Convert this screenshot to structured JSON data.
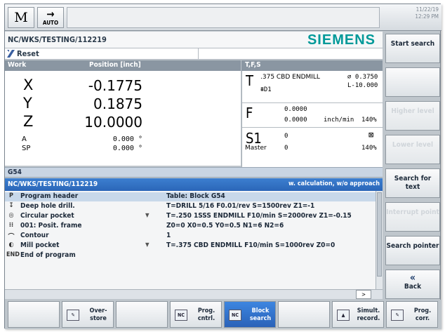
{
  "top": {
    "mode_symbol": "M",
    "mode_auto": "AUTO",
    "date": "11/22/19",
    "time": "12:29 PM"
  },
  "path": "NC/WKS/TESTING/112219",
  "brand": "SIEMENS",
  "status": "Reset",
  "position": {
    "header_work": "Work",
    "header_position": "Position [inch]",
    "axes": [
      {
        "name": "X",
        "value": "-0.1775"
      },
      {
        "name": "Y",
        "value": "0.1875"
      },
      {
        "name": "Z",
        "value": "10.0000"
      }
    ],
    "aux_axes": [
      {
        "name": "A",
        "value": "0.000 °"
      },
      {
        "name": "SP",
        "value": "0.000 °"
      }
    ]
  },
  "tfs": {
    "header": "T,F,S",
    "tool_letter": "T",
    "tool_name": ".375 CBD ENDMILL",
    "tool_diameter": "⌀ 0.3750",
    "tool_length": "L-10.000",
    "tool_edge": "D1",
    "feed_letter": "F",
    "feed_actual": "0.0000",
    "feed_prog": "0.0000",
    "feed_unit": "inch/min",
    "feed_override": "140%",
    "spindle_letter": "S1",
    "spindle_actual": "0",
    "spindle_prog": "0",
    "spindle_override": "140%",
    "spindle_mode": "Master"
  },
  "work_offset": "G54",
  "program": {
    "header_path": "NC/WKS/TESTING/112219",
    "header_note": "w. calculation, w/o approach",
    "rows": [
      {
        "icon": "P",
        "name": "Program header",
        "desc": "Table: Block G54",
        "selected": true,
        "tri": ""
      },
      {
        "icon": "↧",
        "name": "Deep hole drill.",
        "desc": "T=DRILL 5/16 F0.01/rev S=1500rev Z1=-1",
        "selected": false,
        "tri": ""
      },
      {
        "icon": "◎",
        "name": "Circular pocket",
        "desc": "T=.250 1SSS ENDMILL F10/min S=2000rev Z1=-0.15",
        "selected": false,
        "tri": "▼"
      },
      {
        "icon": "⁝⁝",
        "name": "001: Posit. frame",
        "desc": "Z0=0 X0=0.5 Y0=0.5 N1=6 N2=6",
        "selected": false,
        "tri": ""
      },
      {
        "icon": "⌒",
        "name": "Contour",
        "desc": "1",
        "selected": false,
        "tri": ""
      },
      {
        "icon": "◐",
        "name": "Mill pocket",
        "desc": "T=.375 CBD ENDMILL F10/min S=1000rev Z0=0",
        "selected": false,
        "tri": "▼"
      },
      {
        "icon": "END",
        "name": "End of program",
        "desc": "",
        "selected": false,
        "tri": ""
      }
    ],
    "foot_arrow": ">"
  },
  "vertical_softkeys": [
    {
      "label": "Start search",
      "enabled": true
    },
    {
      "label": "",
      "enabled": true
    },
    {
      "label": "Higher level",
      "enabled": false
    },
    {
      "label": "Lower level",
      "enabled": false
    },
    {
      "label": "Search for text",
      "enabled": true
    },
    {
      "label": "Interrupt point",
      "enabled": false
    },
    {
      "label": "Search pointer",
      "enabled": true
    },
    {
      "label": "Back",
      "enabled": true
    }
  ],
  "horizontal_softkeys": [
    {
      "label": "",
      "icon": "",
      "active": false
    },
    {
      "label": "Over-store",
      "icon": "✎",
      "active": false
    },
    {
      "label": "",
      "icon": "",
      "active": false
    },
    {
      "label": "Prog. cntrl.",
      "icon": "NC",
      "active": false
    },
    {
      "label": "Block search",
      "icon": "NC",
      "active": true
    },
    {
      "label": "",
      "icon": "",
      "active": false
    },
    {
      "label": "Simult. record.",
      "icon": "▲",
      "active": false
    },
    {
      "label": "Prog. corr.",
      "icon": "✎",
      "active": false
    }
  ]
}
